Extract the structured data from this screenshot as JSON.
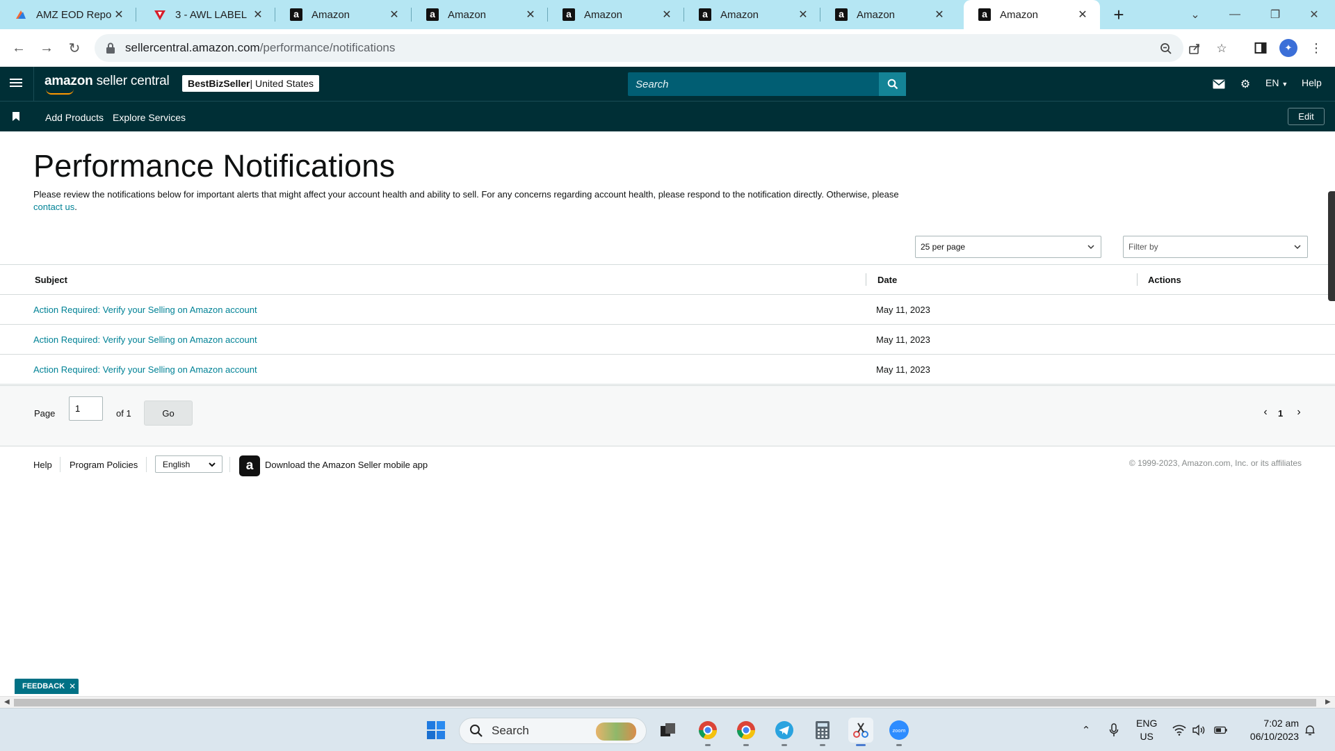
{
  "browser": {
    "tabs": [
      {
        "title": "AMZ EOD Report",
        "icon": "asana-icon"
      },
      {
        "title": "3 - AWL LABEL",
        "icon": "awl-icon"
      },
      {
        "title": "Amazon",
        "icon": "amazon-icon"
      },
      {
        "title": "Amazon",
        "icon": "amazon-icon"
      },
      {
        "title": "Amazon",
        "icon": "amazon-icon"
      },
      {
        "title": "Amazon",
        "icon": "amazon-icon"
      },
      {
        "title": "Amazon",
        "icon": "amazon-icon"
      },
      {
        "title": "Amazon",
        "icon": "amazon-icon",
        "active": true
      }
    ],
    "url_host": "sellercentral.amazon.com",
    "url_path": "/performance/notifications"
  },
  "header": {
    "logo_bold": "amazon",
    "logo_rest": " seller central",
    "store_name": "BestBizSeller",
    "marketplace": " | United States",
    "search_placeholder": "Search",
    "language": "EN",
    "help": "Help"
  },
  "subnav": {
    "links": [
      "Add Products",
      "Explore Services"
    ],
    "edit": "Edit"
  },
  "main": {
    "title": "Performance Notifications",
    "intro_text": "Please review the notifications below for important alerts that might affect your account health and ability to sell. For any concerns regarding account health, please respond to the notification directly. Otherwise, please ",
    "intro_link": "contact us",
    "intro_end": ".",
    "per_page": "25 per page",
    "filter_placeholder": "Filter by"
  },
  "table": {
    "columns": [
      "Subject",
      "Date",
      "Actions"
    ],
    "rows": [
      {
        "subject": "Action Required: Verify your Selling on Amazon account",
        "date": "May 11, 2023"
      },
      {
        "subject": "Action Required: Verify your Selling on Amazon account",
        "date": "May 11, 2023"
      },
      {
        "subject": "Action Required: Verify your Selling on Amazon account",
        "date": "May 11, 2023"
      }
    ]
  },
  "pagination": {
    "page_label": "Page",
    "page_value": "1",
    "of_label": "of 1",
    "go": "Go",
    "current": "1"
  },
  "footer": {
    "help": "Help",
    "policies": "Program Policies",
    "language": "English",
    "app_text": "Download the Amazon Seller mobile app",
    "copyright": "© 1999-2023, Amazon.com, Inc. or its affiliates"
  },
  "feedback": "FEEDBACK",
  "taskbar": {
    "search": "Search",
    "lang_top": "ENG",
    "lang_bottom": "US",
    "time": "7:02 am",
    "date": "06/10/2023"
  },
  "colors": {
    "header_bg": "#002f36",
    "search_bg": "#015e73",
    "link": "#008296",
    "tabstrip": "#b5e6f3"
  }
}
